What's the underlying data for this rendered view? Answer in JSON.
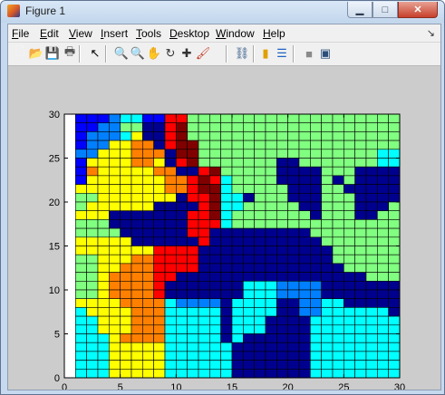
{
  "window": {
    "title": "Figure 1",
    "controls": {
      "minimize": "▁",
      "maximize": "□",
      "close": "✕"
    }
  },
  "menubar": {
    "items": [
      {
        "label": "File",
        "accel": "F"
      },
      {
        "label": "Edit",
        "accel": "E"
      },
      {
        "label": "View",
        "accel": "V"
      },
      {
        "label": "Insert",
        "accel": "I"
      },
      {
        "label": "Tools",
        "accel": "T"
      },
      {
        "label": "Desktop",
        "accel": "D"
      },
      {
        "label": "Window",
        "accel": "W"
      },
      {
        "label": "Help",
        "accel": "H"
      }
    ],
    "dock_icon": "↘"
  },
  "toolbar": {
    "buttons": [
      {
        "name": "new-figure-icon",
        "glyph": "🗋",
        "color": "#f6f6f6"
      },
      {
        "name": "open-file-icon",
        "glyph": "📂",
        "color": "#e8c254"
      },
      {
        "name": "save-icon",
        "glyph": "💾",
        "color": "#3a59a8"
      },
      {
        "name": "print-icon",
        "glyph": "🖶",
        "color": "#555555"
      },
      {
        "name": "select-arrow-icon",
        "glyph": "↖",
        "color": "#000000"
      },
      {
        "name": "zoom-in-icon",
        "glyph": "🔍",
        "color": "#1e63c4"
      },
      {
        "name": "zoom-out-icon",
        "glyph": "🔍",
        "color": "#1e63c4"
      },
      {
        "name": "pan-hand-icon",
        "glyph": "✋",
        "color": "#b98a4e"
      },
      {
        "name": "rotate-3d-icon",
        "glyph": "↻",
        "color": "#333333"
      },
      {
        "name": "data-cursor-icon",
        "glyph": "✚",
        "color": "#333333"
      },
      {
        "name": "brush-icon",
        "glyph": "🖌",
        "color": "#c23b22"
      },
      {
        "name": "link-plot-icon",
        "glyph": "⛓",
        "color": "#3b5f8c"
      },
      {
        "name": "colorbar-icon",
        "glyph": "▮",
        "color": "#e0a000"
      },
      {
        "name": "legend-icon",
        "glyph": "☰",
        "color": "#1e63c4"
      },
      {
        "name": "hide-plot-tools-icon",
        "glyph": "■",
        "color": "#8a8a8a"
      },
      {
        "name": "show-plot-tools-icon",
        "glyph": "▣",
        "color": "#2b4f7a"
      }
    ]
  },
  "chart_data": {
    "type": "heatmap",
    "colormap": "jet",
    "cmap_colors": [
      "#00008f",
      "#0000ff",
      "#0080ff",
      "#00ffff",
      "#80ff80",
      "#ffff00",
      "#ff8000",
      "#ff0000",
      "#800000"
    ],
    "xlim": [
      0,
      30
    ],
    "ylim": [
      0,
      30
    ],
    "xticks": [
      0,
      5,
      10,
      15,
      20,
      25,
      30
    ],
    "yticks": [
      0,
      5,
      10,
      15,
      20,
      25,
      30
    ],
    "grid_x_range": [
      1,
      30
    ],
    "grid_y_range": [
      1,
      30
    ],
    "levels_rows_top_to_bottom": [
      "1112331177444444444444444444440",
      "1122440078444444444444444444440",
      "1222350078444444444444444444440",
      "1225566078844444444444444444440",
      "2255566608844444444444444443344",
      "1555566507844444440044444443344",
      "1655555660078444440000444000044",
      "1555555566787344440000404000004",
      "5555555566788344444000440000004",
      "4455555550778330444000444000044",
      "4555555000078334444400444000444",
      "5550000000778344444440444004444",
      "4440000000777344444444444444444",
      "4444000000770000000004444444444",
      "5555500000070000000000444444444",
      "5555555777700000000000044444444",
      "4455566777700000000000044444444",
      "4455666777700000000000004444444",
      "4456666770000000000000000044444",
      "4456666700000003332222000000044",
      "4456666700000003332222000000044",
      "5555666632222033330022330000044",
      "3555566633333033330022333333000",
      "3355566633333033300003333333300",
      "3355566633333033300003333333330",
      "3335666633333030000003333333330",
      "3335555533333300000003333333333",
      "3335555533333300000003333333333",
      "3335555533333300000003333333333",
      "3335555533333300000003333333333"
    ]
  }
}
